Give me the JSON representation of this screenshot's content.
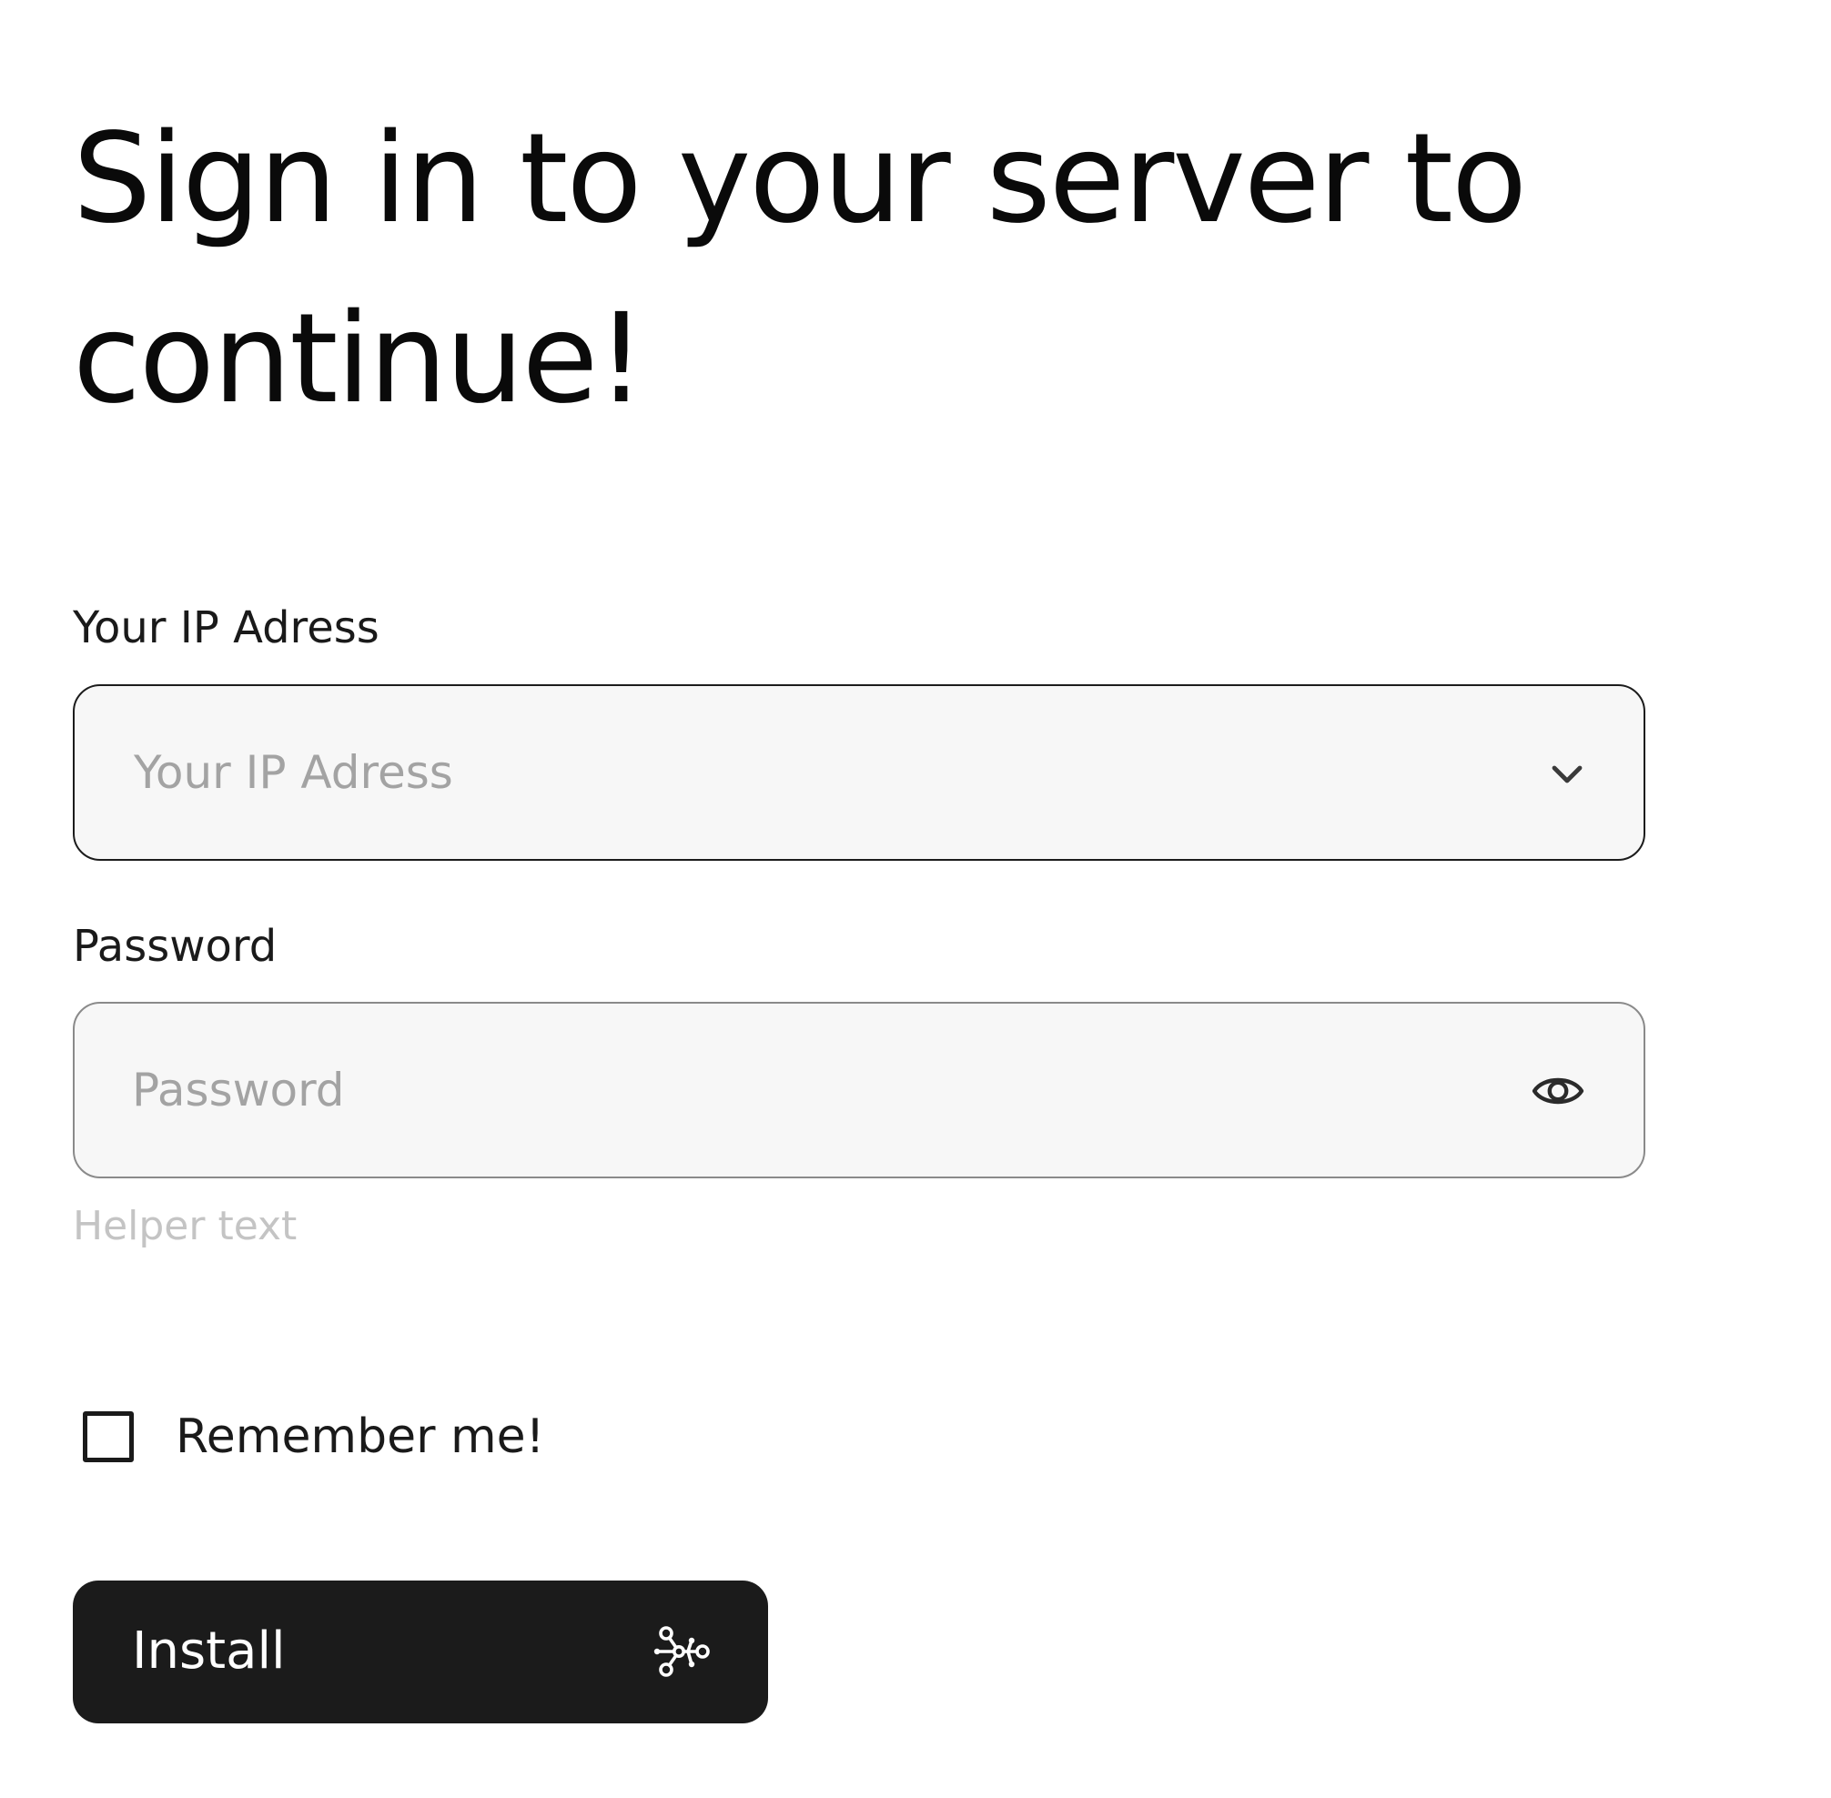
{
  "header": {
    "title": "Sign in to your server to continue!"
  },
  "form": {
    "ip_field": {
      "label": "Your IP Adress",
      "placeholder": "Your IP Adress",
      "icon": "chevron-down-icon"
    },
    "password_field": {
      "label": "Password",
      "placeholder": "Password",
      "helper_text": "Helper text",
      "icon": "eye-icon"
    },
    "remember_me": {
      "label": "Remember me!",
      "checked": false
    },
    "submit": {
      "label": "Install",
      "icon": "network-icon",
      "background": "#1b1b1b",
      "text_color": "#ffffff"
    }
  },
  "colors": {
    "field_background": "#f7f7f7",
    "placeholder": "#a3a3a3",
    "helper": "#c4c4c4"
  }
}
